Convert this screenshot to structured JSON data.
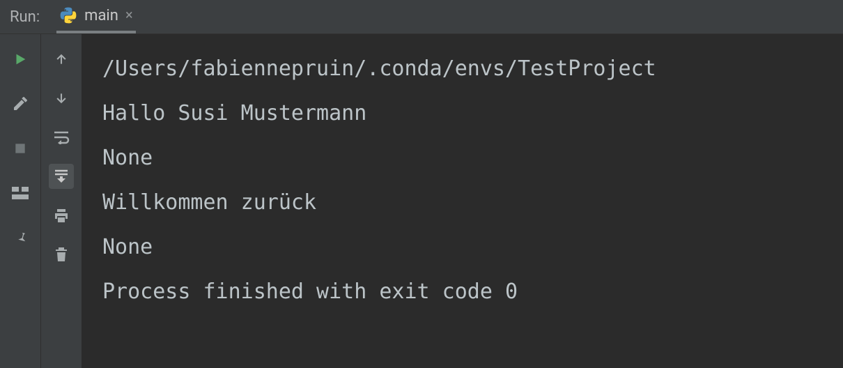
{
  "header": {
    "label": "Run:",
    "tab": {
      "label": "main"
    }
  },
  "console": {
    "lines": [
      "/Users/fabiennepruin/.conda/envs/TestProject",
      "Hallo Susi Mustermann",
      "None",
      "Willkommen zurück",
      "None",
      "",
      "Process finished with exit code 0"
    ]
  },
  "icons": {
    "run": "▶",
    "wrench": "wrench",
    "stop": "■",
    "layout": "layout",
    "pin": "pin",
    "up": "↑",
    "down": "↓",
    "wrap": "wrap",
    "scroll_end": "scroll-to-end",
    "print": "print",
    "trash": "trash"
  }
}
